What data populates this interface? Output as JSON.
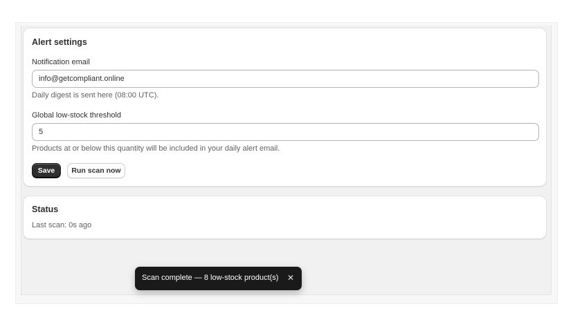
{
  "alert_settings": {
    "title": "Alert settings",
    "email_label": "Notification email",
    "email_value": "info@getcompliant.online",
    "email_help": "Daily digest is sent here (08:00 UTC).",
    "threshold_label": "Global low-stock threshold",
    "threshold_value": "5",
    "threshold_help": "Products at or below this quantity will be included in your daily alert email.",
    "save_label": "Save",
    "run_scan_label": "Run scan now"
  },
  "status": {
    "title": "Status",
    "last_scan": "Last scan: 0s ago"
  },
  "toast": {
    "message": "Scan complete — 8 low-stock product(s)",
    "close_icon": "close-icon",
    "close_glyph": "✕"
  },
  "colors": {
    "primary_button": "#303030",
    "toast_background": "#1a1a1a",
    "page_background": "#f1f1f1"
  }
}
